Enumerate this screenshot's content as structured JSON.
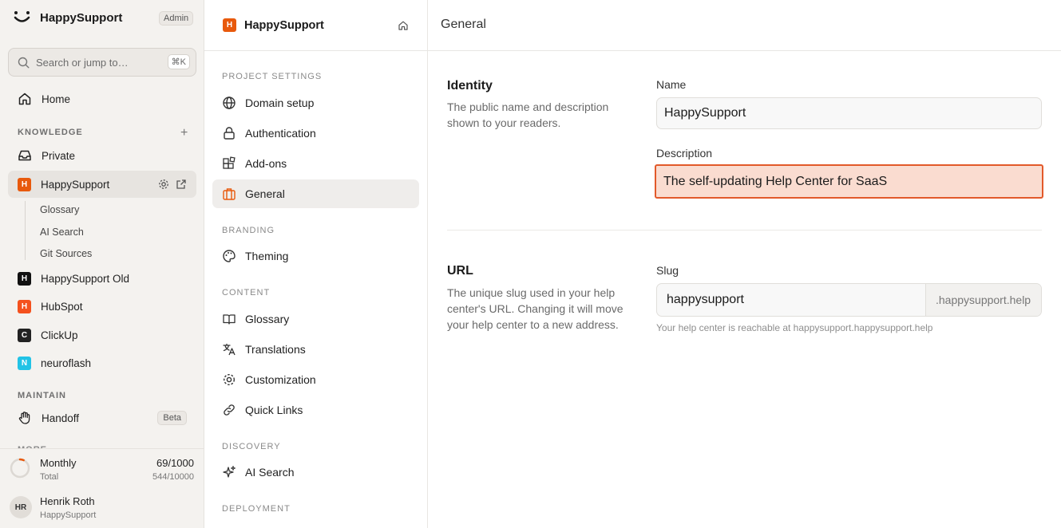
{
  "sidebar": {
    "brand": "HappySupport",
    "role_badge": "Admin",
    "search": {
      "placeholder": "Search or jump to…",
      "shortcut": "⌘K"
    },
    "home_label": "Home",
    "knowledge_label": "KNOWLEDGE",
    "private_label": "Private",
    "projects": [
      {
        "initial": "H",
        "name": "HappySupport",
        "color": "#e8590c"
      },
      {
        "initial": "H",
        "name": "HappySupport Old",
        "color": "#111111"
      },
      {
        "initial": "H",
        "name": "HubSpot",
        "color": "#f4511e"
      },
      {
        "initial": "C",
        "name": "ClickUp",
        "color": "#222222"
      },
      {
        "initial": "N",
        "name": "neuroflash",
        "color": "#22c3e6"
      }
    ],
    "sub_items": [
      "Glossary",
      "AI Search",
      "Git Sources"
    ],
    "maintain_label": "MAINTAIN",
    "handoff_label": "Handoff",
    "handoff_badge": "Beta",
    "more_label": "MORE",
    "usage": {
      "title": "Monthly",
      "value": "69/1000",
      "subtitle": "Total",
      "total": "544/10000",
      "fraction": 0.069
    },
    "user": {
      "initials": "HR",
      "name": "Henrik Roth",
      "org": "HappySupport"
    }
  },
  "settings_nav": {
    "project_initial": "H",
    "project_name": "HappySupport",
    "sections": {
      "project_settings": "PROJECT SETTINGS",
      "branding": "BRANDING",
      "content": "CONTENT",
      "discovery": "DISCOVERY",
      "deployment": "DEPLOYMENT"
    },
    "items": {
      "domain_setup": "Domain setup",
      "authentication": "Authentication",
      "addons": "Add-ons",
      "general": "General",
      "theming": "Theming",
      "glossary": "Glossary",
      "translations": "Translations",
      "customization": "Customization",
      "quick_links": "Quick Links",
      "ai_search": "AI Search"
    }
  },
  "main": {
    "title": "General",
    "identity": {
      "title": "Identity",
      "description": "The public name and description shown to your readers.",
      "name_label": "Name",
      "name_value": "HappySupport",
      "description_label": "Description",
      "description_value": "The self-updating Help Center for SaaS"
    },
    "url": {
      "title": "URL",
      "description": "The unique slug used in your help center's URL. Changing it will move your help center to a new address.",
      "slug_label": "Slug",
      "slug_value": "happysupport",
      "slug_suffix": ".happysupport.help",
      "hint": "Your help center is reachable at happysupport.happysupport.help"
    }
  },
  "colors": {
    "accent": "#e8590c",
    "focus_fill": "#fadcd0",
    "focus_border": "#e2592a"
  }
}
